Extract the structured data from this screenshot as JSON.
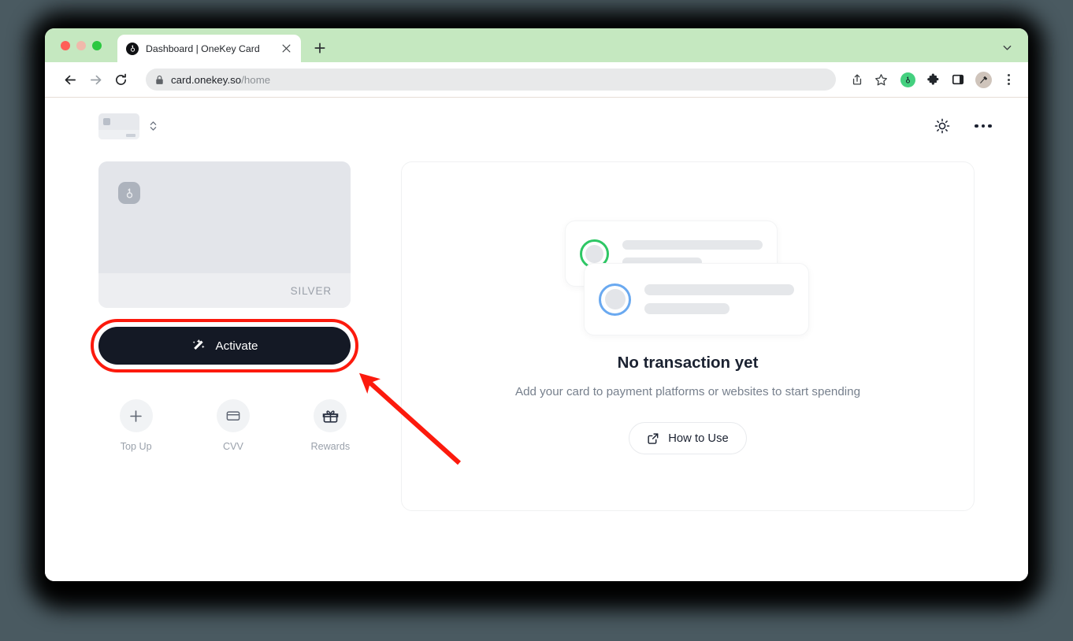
{
  "browser": {
    "tab": {
      "title": "Dashboard | OneKey Card",
      "favicon": "onekey-key-icon",
      "close_label": "×"
    },
    "newtab_label": "+",
    "url": "card.onekey.so",
    "url_path": "/home",
    "lock_icon": "lock-icon",
    "nav": {
      "back": "back-arrow-icon",
      "forward": "forward-arrow-icon",
      "reload": "reload-icon"
    },
    "actions": {
      "share": "share-icon",
      "bookmark": "star-icon"
    },
    "extensions": [
      {
        "name": "onekey-extension-icon"
      },
      {
        "name": "puzzle-extensions-icon"
      },
      {
        "name": "side-panel-icon"
      },
      {
        "name": "profile-avatar-icon"
      }
    ],
    "menu": "chrome-menu-icon",
    "tabstrip_expander": "chevron-down-icon"
  },
  "app": {
    "header": {
      "card_switcher": {
        "name": "mini-card-skeleton",
        "chevrons": "up-down-chevron-icon"
      },
      "theme_toggle": "sun-icon",
      "more_menu": "more-horizontal-icon"
    },
    "card": {
      "tier": "SILVER",
      "logo": "onekey-logo-icon"
    },
    "activate": {
      "label": "Activate",
      "icon": "magic-wand-sparkle-icon"
    },
    "quick_actions": [
      {
        "label": "Top Up",
        "icon": "plus-icon"
      },
      {
        "label": "CVV",
        "icon": "credit-card-icon"
      },
      {
        "label": "Rewards",
        "icon": "gift-icon"
      }
    ],
    "transactions": {
      "empty_title": "No transaction yet",
      "empty_subtitle": "Add your card to payment platforms or websites to start spending",
      "how_to_use_label": "How to Use",
      "how_to_use_icon": "external-link-icon",
      "skeleton_rings": [
        "#2ec765",
        "#6aa9f0"
      ]
    }
  },
  "annotation": {
    "type": "arrow",
    "color": "#fc1a0d",
    "target": "activate-button",
    "highlight_shape": "rounded-rectangle"
  }
}
